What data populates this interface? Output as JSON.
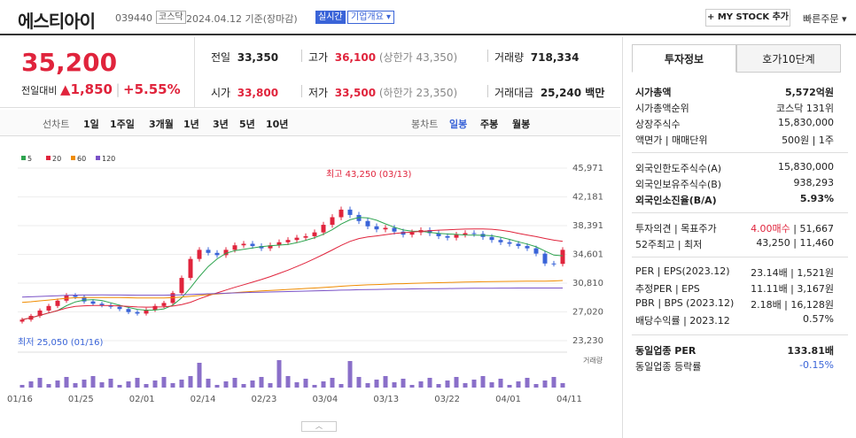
{
  "header": {
    "name": "에스티아이",
    "code": "039440",
    "market": "코스닥",
    "date": "2024.04.12 기준(장마감)",
    "live": "실시간",
    "corp_info": "기업개요 ▾",
    "my_stock": "+ MY STOCK 추가",
    "quick_order": "빠른주문 ▾"
  },
  "quote": {
    "price": "35,200",
    "change_label": "전일대비",
    "change": "▲1,850",
    "change_pct": "+5.55%",
    "prev_label": "전일",
    "prev": "33,350",
    "high_label": "고가",
    "high": "36,100",
    "upper_limit": "(상한가 43,350)",
    "volume_label": "거래량",
    "volume": "718,334",
    "open_label": "시가",
    "open": "33,800",
    "low_label": "저가",
    "low": "33,500",
    "lower_limit": "(하한가 23,350)",
    "amount_label": "거래대금",
    "amount": "25,240 백만"
  },
  "periods": {
    "line_chart": "선차트",
    "items": [
      "1일",
      "1주일",
      "3개월",
      "1년",
      "3년",
      "5년",
      "10년"
    ],
    "candle_chart": "봉차트",
    "candle_items": [
      "일봉",
      "주봉",
      "월봉"
    ]
  },
  "chart_data": {
    "type": "line",
    "legend": [
      "5",
      "20",
      "60",
      "120"
    ],
    "legend_colors": [
      "#2ea44f",
      "#e0243c",
      "#f08c00",
      "#7a52c7"
    ],
    "y_ticks": [
      "45,971",
      "42,181",
      "38,391",
      "34,601",
      "30,810",
      "27,020",
      "23,230"
    ],
    "x_ticks": [
      "01/16",
      "01/25",
      "02/01",
      "02/14",
      "02/23",
      "03/04",
      "03/13",
      "03/22",
      "04/01",
      "04/11"
    ],
    "max_label": "최고 43,250 (03/13)",
    "min_label": "최저 25,050 (01/16)",
    "volume_label": "거래량",
    "closes": [
      26000,
      26500,
      27200,
      27800,
      28500,
      29200,
      29000,
      28400,
      28100,
      27900,
      27700,
      27400,
      27000,
      26800,
      27300,
      27800,
      28200,
      29500,
      31500,
      34000,
      35200,
      34800,
      34500,
      35200,
      35800,
      36000,
      35700,
      35400,
      35800,
      36200,
      36500,
      36800,
      37000,
      37500,
      38500,
      39500,
      40500,
      39800,
      39000,
      38300,
      37900,
      38100,
      37600,
      37200,
      37500,
      37800,
      37400,
      37000,
      36800,
      37200,
      37400,
      37300,
      36900,
      36500,
      36200,
      36000,
      35700,
      35400,
      34700,
      33400,
      33350,
      35200
    ],
    "ylim": [
      23230,
      45971
    ]
  },
  "invest": {
    "tab_on": "투자정보",
    "tab_off": "호가10단계",
    "market_cap_label": "시가총액",
    "market_cap": "5,572억원",
    "rank_label": "시가총액순위",
    "rank": "코스닥 131위",
    "shares_label": "상장주식수",
    "shares": "15,830,000",
    "par_label": "액면가 | 매매단위",
    "par": "500원 | 1주",
    "foreign_limit_label": "외국인한도주식수(A)",
    "foreign_limit": "15,830,000",
    "foreign_hold_label": "외국인보유주식수(B)",
    "foreign_hold": "938,293",
    "foreign_ratio_label": "외국인소진율(B/A)",
    "foreign_ratio": "5.93%",
    "opinion_label": "투자의견 | 목표주가",
    "opinion": "4.00매수",
    "target": "51,667",
    "week52_label": "52주최고 | 최저",
    "week52": "43,250 | 11,460",
    "per_label": "PER | EPS(2023.12)",
    "per": "23.14배 | 1,521원",
    "est_per_label": "추정PER | EPS",
    "est_per": "11.11배 | 3,167원",
    "pbr_label": "PBR | BPS (2023.12)",
    "pbr": "2.18배 | 16,128원",
    "div_label": "배당수익률 | 2023.12",
    "div": "0.57%",
    "sector_per_label": "동일업종 PER",
    "sector_per": "133.81배",
    "sector_rate_label": "동일업종 등락률",
    "sector_rate": "-0.15%"
  }
}
